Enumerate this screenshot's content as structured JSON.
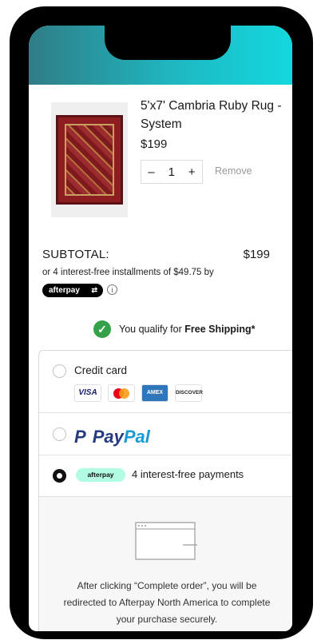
{
  "item": {
    "title": "5'x7' Cambria Ruby Rug - System",
    "price": "$199",
    "qty_minus": "–",
    "quantity": "1",
    "qty_plus": "+",
    "remove_label": "Remove"
  },
  "summary": {
    "subtotal_label": "SUBTOTAL:",
    "subtotal_value": "$199",
    "installments_text": "or 4 interest-free installments of $49.75 by",
    "afterpay_badge": "afterpay",
    "info_symbol": "i"
  },
  "shipping": {
    "qualify_text": "You qualify for",
    "free_shipping": "Free Shipping*"
  },
  "payment": {
    "credit_card_label": "Credit card",
    "cards": [
      "VISA",
      "AMEX",
      "DISCOVER"
    ],
    "paypal_pay": "Pay",
    "paypal_pal": "Pal",
    "afterpay_pill": "afterpay",
    "afterpay_text": "4 interest-free payments",
    "selected": "afterpay",
    "redirect_text": "After clicking “Complete order”, you will be redirected to Afterpay North America to complete your purchase securely."
  },
  "colors": {
    "header_gradient_start": "#2f7d86",
    "header_gradient_end": "#13d8de",
    "check_green": "#35a149",
    "afterpay_mint": "#b2fce4",
    "paypal_blue_dark": "#253b80",
    "paypal_blue_light": "#179bd7"
  },
  "icons": [
    "check-icon",
    "info-icon",
    "visa-icon",
    "mastercard-icon",
    "amex-icon",
    "discover-icon",
    "paypal-logo",
    "browser-redirect-icon"
  ]
}
